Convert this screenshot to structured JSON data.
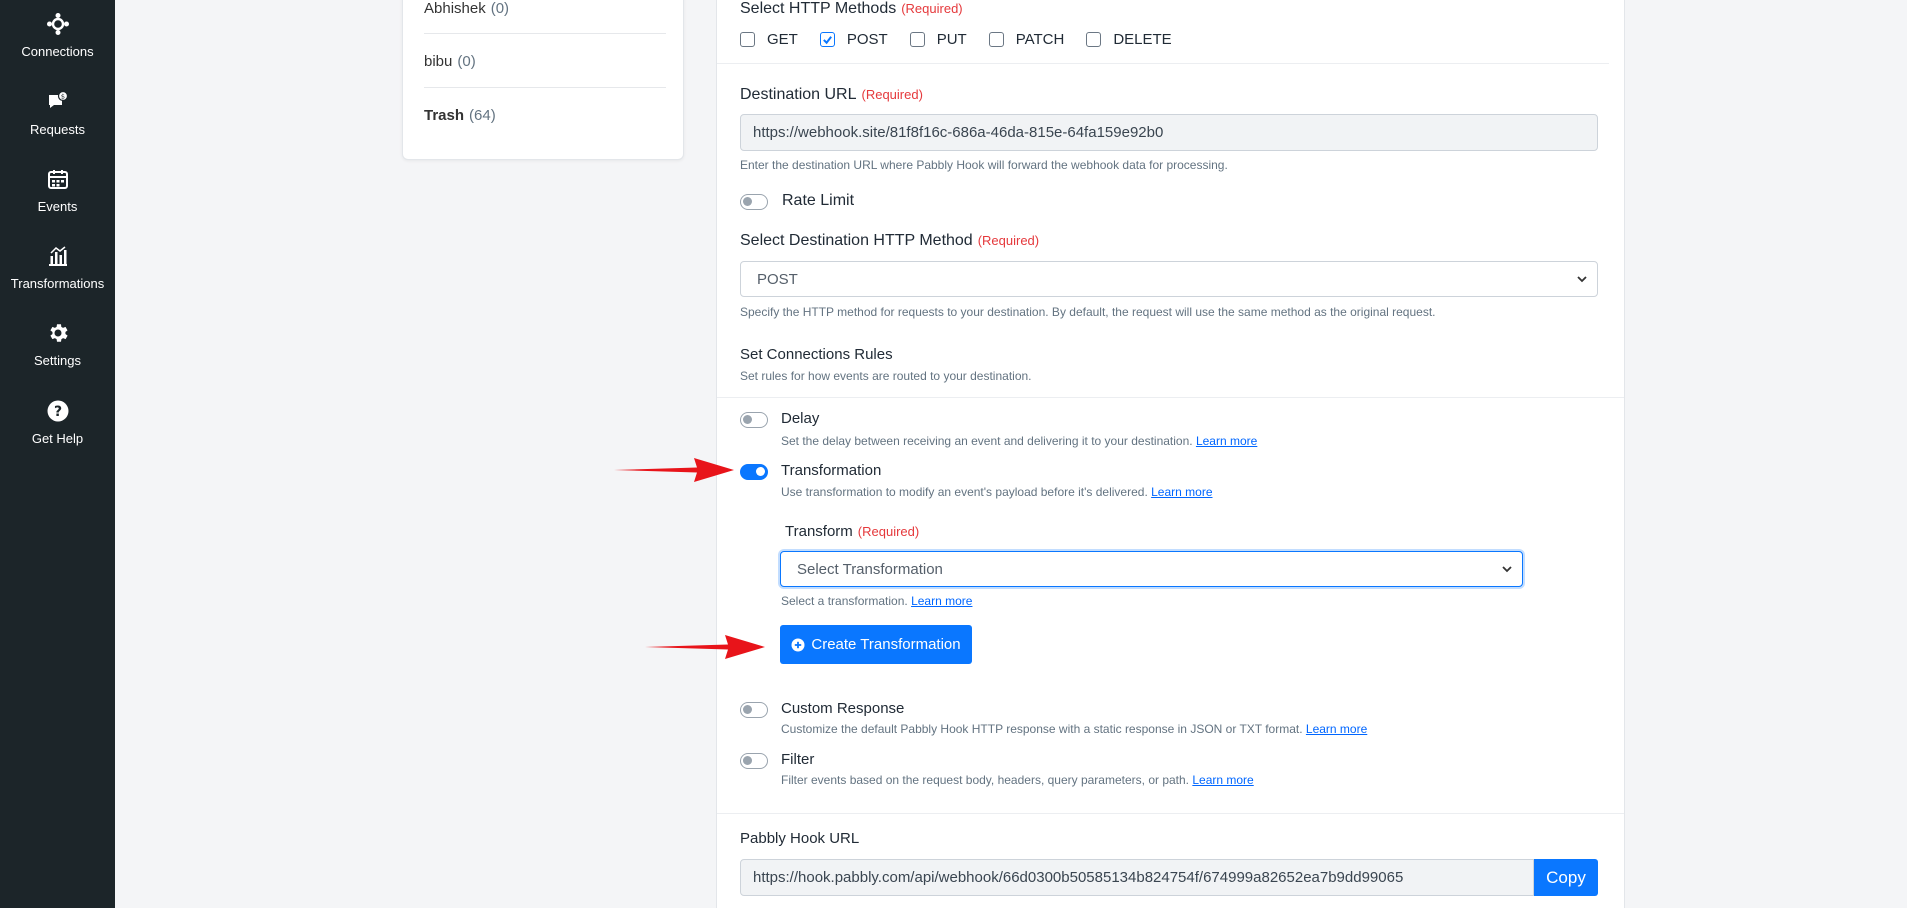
{
  "sidebar": {
    "items": [
      {
        "label": "Connections",
        "icon": "connections-icon"
      },
      {
        "label": "Requests",
        "icon": "requests-icon"
      },
      {
        "label": "Events",
        "icon": "events-icon"
      },
      {
        "label": "Transformations",
        "icon": "transformations-icon"
      },
      {
        "label": "Settings",
        "icon": "gear-icon"
      },
      {
        "label": "Get Help",
        "icon": "help-icon"
      }
    ]
  },
  "folders": {
    "items": [
      {
        "name": "Abhishek",
        "count": "(0)"
      },
      {
        "name": "bibu",
        "count": "(0)"
      },
      {
        "name": "Trash",
        "count": "(64)"
      }
    ]
  },
  "form": {
    "http_methods": {
      "label": "Select HTTP Methods",
      "required": "(Required)",
      "options": [
        {
          "label": "GET",
          "checked": false
        },
        {
          "label": "POST",
          "checked": true
        },
        {
          "label": "PUT",
          "checked": false
        },
        {
          "label": "PATCH",
          "checked": false
        },
        {
          "label": "DELETE",
          "checked": false
        }
      ]
    },
    "destination_url": {
      "label": "Destination URL",
      "required": "(Required)",
      "value": "https://webhook.site/81f8f16c-686a-46da-815e-64fa159e92b0",
      "help": "Enter the destination URL where Pabbly Hook will forward the webhook data for processing."
    },
    "rate_limit": {
      "label": "Rate Limit",
      "enabled": false
    },
    "dest_method": {
      "label": "Select Destination HTTP Method",
      "required": "(Required)",
      "value": "POST",
      "help": "Specify the HTTP method for requests to your destination. By default, the request will use the same method as the original request."
    },
    "rules": {
      "title": "Set Connections Rules",
      "subtitle": "Set rules for how events are routed to your destination."
    },
    "delay": {
      "label": "Delay",
      "enabled": false,
      "help": "Set the delay between receiving an event and delivering it to your destination.",
      "link": "Learn more"
    },
    "transformation": {
      "label": "Transformation",
      "enabled": true,
      "help": "Use transformation to modify an event's payload before it's delivered.",
      "link": "Learn more"
    },
    "transform": {
      "label": "Transform",
      "required": "(Required)",
      "value": "Select Transformation",
      "help": "Select a transformation.",
      "link": "Learn more",
      "create_label": "Create Transformation"
    },
    "custom_response": {
      "label": "Custom Response",
      "enabled": false,
      "help": "Customize the default Pabbly Hook HTTP response with a static response in JSON or TXT format.",
      "link": "Learn more"
    },
    "filter": {
      "label": "Filter",
      "enabled": false,
      "help": "Filter events based on the request body, headers, query parameters, or path.",
      "link": "Learn more"
    },
    "hook_url": {
      "label": "Pabbly Hook URL",
      "value": "https://hook.pabbly.com/api/webhook/66d0300b50585134b824754f/674999a82652ea7b9dd99065",
      "copy_label": "Copy"
    }
  },
  "colors": {
    "accent": "#0a77ff",
    "sidebar_bg": "#1c2529",
    "required": "#e5393c",
    "annotation_arrow": "#e8141a"
  }
}
